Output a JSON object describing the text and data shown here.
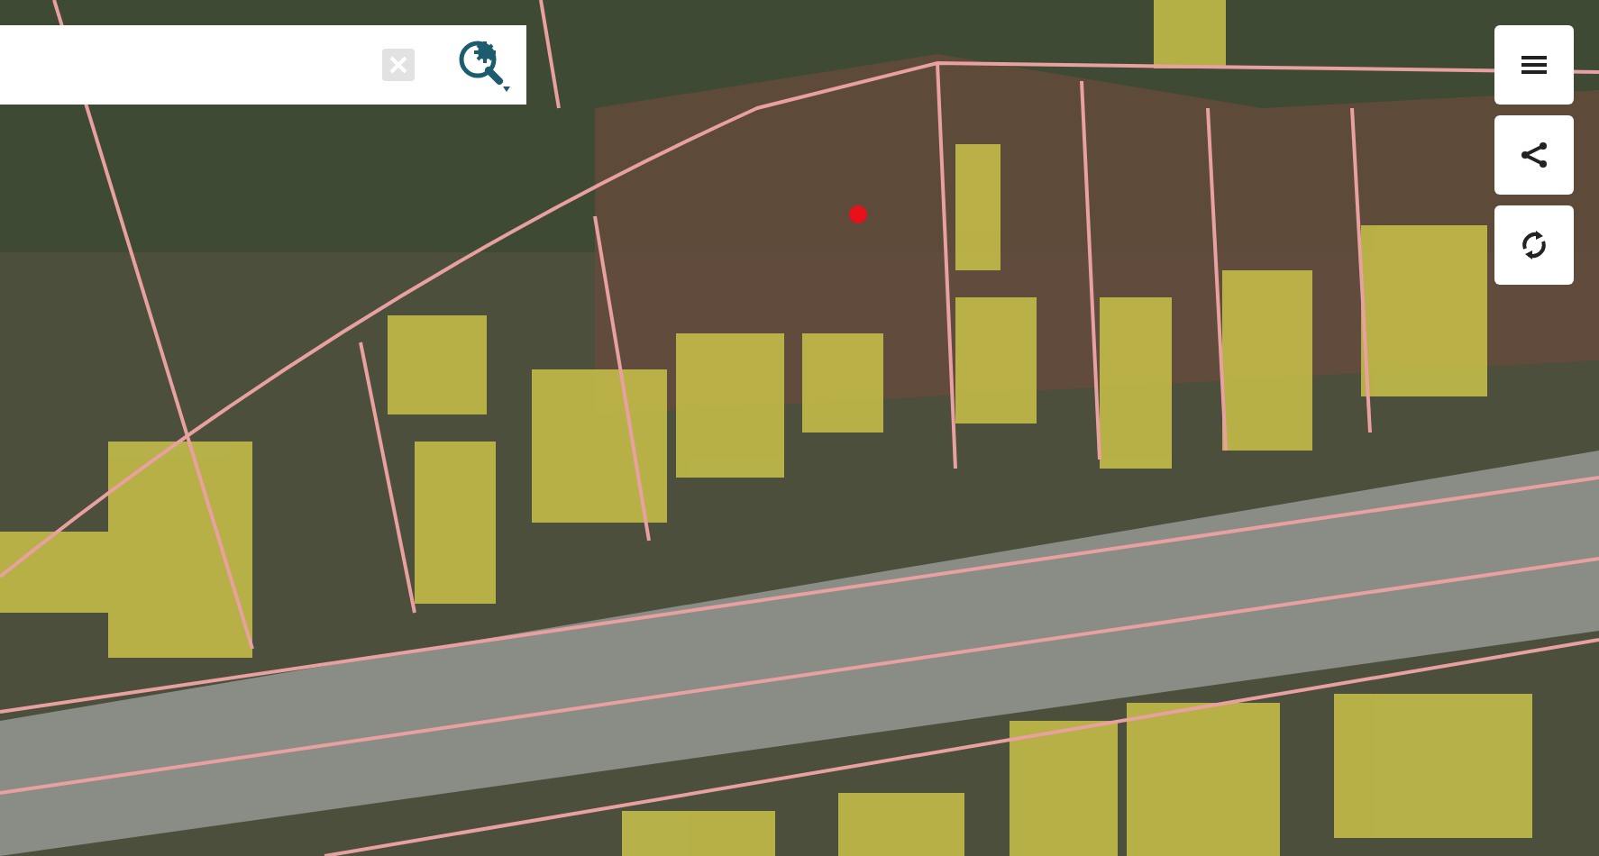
{
  "map": {
    "marker": true
  },
  "search": {
    "clear_disabled": true
  },
  "toolbar": [
    {
      "kind": "menu"
    },
    {
      "kind": "share"
    },
    {
      "kind": "rotate"
    }
  ]
}
